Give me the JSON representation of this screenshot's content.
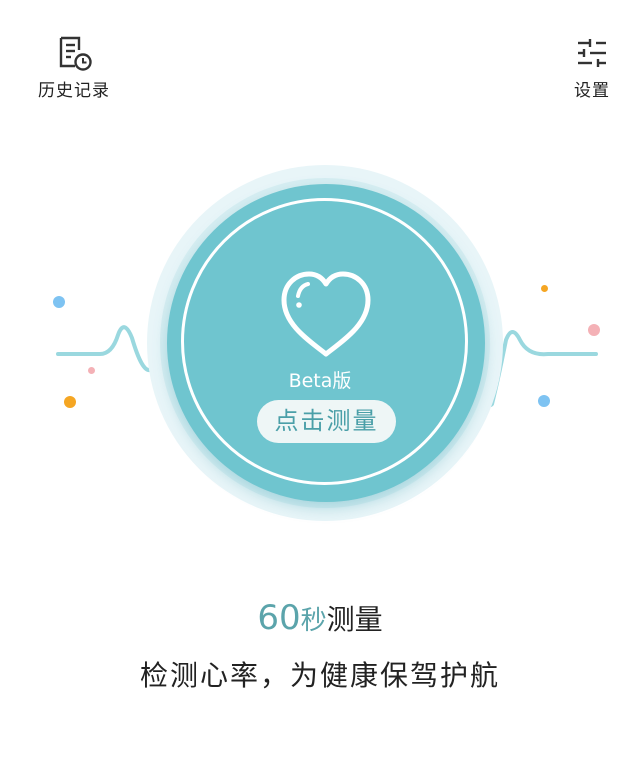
{
  "header": {
    "history_label": "历史记录",
    "settings_label": "设置"
  },
  "main": {
    "beta_label": "Beta版",
    "measure_button": "点击测量"
  },
  "caption": {
    "seconds_number": "60",
    "seconds_unit": "秒",
    "measure_word": "测量",
    "tagline": "检测心率，为健康保驾护航"
  },
  "colors": {
    "accent": "#6fc5cf",
    "accent_text": "#5ba4ab",
    "wave": "#9ad8df"
  }
}
